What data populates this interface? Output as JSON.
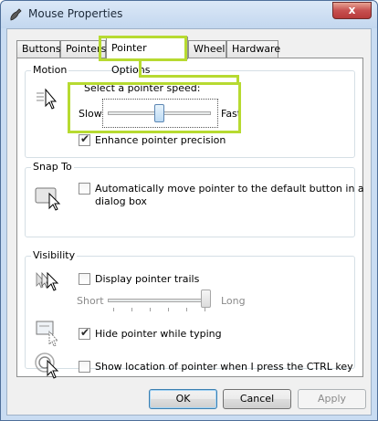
{
  "window": {
    "title": "Mouse Properties",
    "close_glyph": "x"
  },
  "tabs": [
    {
      "label": "Buttons"
    },
    {
      "label": "Pointers"
    },
    {
      "label": "Pointer Options",
      "active": true
    },
    {
      "label": "Wheel"
    },
    {
      "label": "Hardware"
    }
  ],
  "motion": {
    "group_label": "Motion",
    "speed_label": "Select a pointer speed:",
    "slow_label": "Slow",
    "fast_label": "Fast",
    "speed_value": 0.5,
    "enhance_label": "Enhance pointer precision",
    "enhance_checked": true,
    "icon": "pointer-speed-icon"
  },
  "snap_to": {
    "group_label": "Snap To",
    "auto_label_line1": "Automatically move pointer to the default button in a",
    "auto_label_line2": "dialog box",
    "auto_checked": false,
    "icon": "snap-to-icon"
  },
  "visibility": {
    "group_label": "Visibility",
    "trails_label": "Display pointer trails",
    "trails_checked": false,
    "short_label": "Short",
    "long_label": "Long",
    "trails_value": 1.0,
    "hide_label": "Hide pointer while typing",
    "hide_checked": true,
    "show_label": "Show location of pointer when I press the CTRL key",
    "show_checked": false,
    "icons": [
      "pointer-trails-icon",
      "hide-pointer-icon",
      "show-location-icon"
    ]
  },
  "buttons": {
    "ok": "OK",
    "cancel": "Cancel",
    "apply": "Apply"
  },
  "colors": {
    "highlight": "#b7da31",
    "title_bg": "#c9dcf2"
  }
}
